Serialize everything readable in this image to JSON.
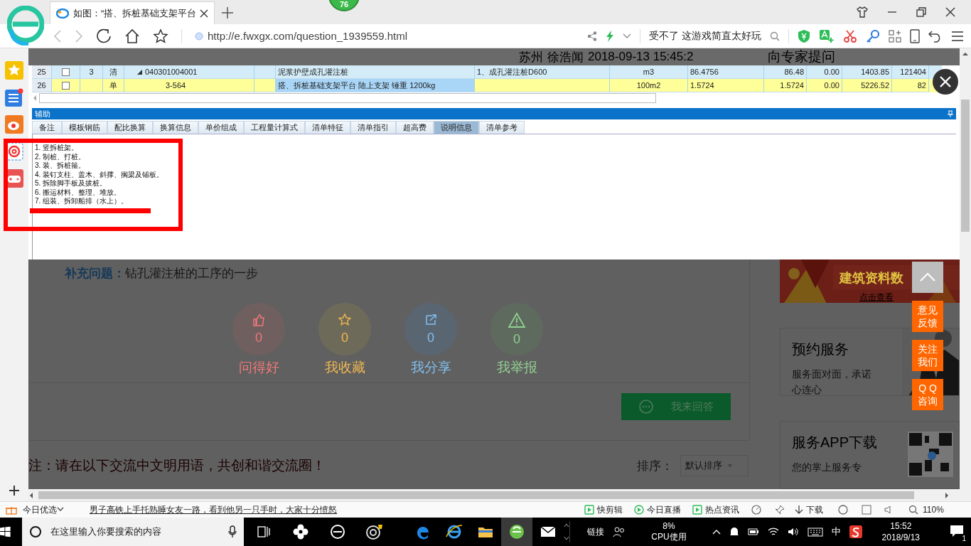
{
  "browser": {
    "tab_title": "如图：“搭、拆桩基础支架平台",
    "badge": "76",
    "url": "http://e.fwxgx.com/question_1939559.html",
    "search_hint": "受不了 这游戏简直太好玩"
  },
  "page_header": {
    "location": "苏州",
    "author": "徐浩闻",
    "time": "2018-09-13 15:45:2",
    "ask_button": "向专家提问"
  },
  "grid": {
    "rows": [
      {
        "kind": "list",
        "index": "25",
        "checked": false,
        "level_no": "3",
        "type": "清",
        "code": "040301004001",
        "expanded": true,
        "name": "泥浆护壁成孔灌注桩",
        "name_selected": false,
        "feature": "1、成孔灌注桩D600",
        "unit": "m3",
        "quantity": "86.4756",
        "column_11": "86.48",
        "column_12": "0.00",
        "column_13": "1403.85",
        "column_14": "121404"
      },
      {
        "kind": "quota",
        "index": "26",
        "checked": false,
        "level_no": "",
        "type": "单",
        "code": "3-564",
        "name": "搭、拆桩基础支架平台 陆上支架 锤重 1200kg",
        "name_selected": true,
        "feature": "",
        "unit": "100m2",
        "quantity": "1.5724",
        "column_11": "1.5724",
        "column_12": "0.00",
        "column_13": "5226.52",
        "column_14": "82"
      }
    ]
  },
  "aux": {
    "title": "辅助",
    "tabs": [
      {
        "label": "备注",
        "selected": false
      },
      {
        "label": "模板钢筋",
        "selected": false
      },
      {
        "label": "配比换算",
        "selected": false
      },
      {
        "label": "换算信息",
        "selected": false
      },
      {
        "label": "单价组成",
        "selected": false
      },
      {
        "label": "工程量计算式",
        "selected": false
      },
      {
        "label": "清单特征",
        "selected": false
      },
      {
        "label": "清单指引",
        "selected": false
      },
      {
        "label": "超高费",
        "selected": false
      },
      {
        "label": "说明信息",
        "selected": true
      },
      {
        "label": "清单参考",
        "selected": false
      }
    ],
    "lines": [
      "1. 竖拆桩架。",
      "2. 制桩、打桩。",
      "3. 装、拆桩箍。",
      "4. 装钉支柱、盖木、斜撑、搁梁及铺板。",
      "5. 拆除脚手板及拔桩。",
      "6. 搬运材料、整理、堆放。",
      "7. 组装、拆卸船排（水上）。"
    ]
  },
  "question": {
    "supplement_label": "补充问题：",
    "supplement": "钻孔灌注桩的工序的一步",
    "actions": [
      {
        "kind": "like",
        "count": "0",
        "label": "问得好",
        "color": "#f07878"
      },
      {
        "kind": "favorite",
        "count": "0",
        "label": "我收藏",
        "color": "#f0b850"
      },
      {
        "kind": "share",
        "count": "0",
        "label": "我分享",
        "color": "#80c0f0"
      },
      {
        "kind": "report",
        "count": "0",
        "label": "我举报",
        "color": "#90d090"
      }
    ],
    "answer_button": "我来回答",
    "notice": "注：请在以下交流中文明用语，共创和谐交流圈！",
    "sort_label": "排序：",
    "sort_select": "默认排序"
  },
  "side": {
    "banner_title": "建筑资料数",
    "banner_link": "点击查看",
    "service_title": "预约服务",
    "service_desc": "服务面对面，承诺心连心",
    "app_title": "服务APP下载",
    "app_desc": "您的掌上服务专"
  },
  "float_buttons": [
    {
      "lines": [
        "意见",
        "反馈"
      ]
    },
    {
      "lines": [
        "关注",
        "我们"
      ]
    },
    {
      "lines": [
        "Q Q",
        "咨询"
      ]
    }
  ],
  "status_bar": {
    "left_label": "今日优选",
    "headline": "男子高铁上手托熟睡女友一路，看到他另一只手时，大家十分愤怒",
    "items": [
      "快剪辑",
      "今日直播",
      "热点资讯"
    ],
    "download": "下载",
    "zoom": "110%"
  },
  "taskbar": {
    "search_placeholder": "在这里输入你要搜索的内容",
    "links": "链接",
    "cpu_value": "8%",
    "cpu_label": "CPU使用",
    "ime": "中",
    "time": "15:52",
    "date": "2018/9/13",
    "notifications": "1"
  }
}
